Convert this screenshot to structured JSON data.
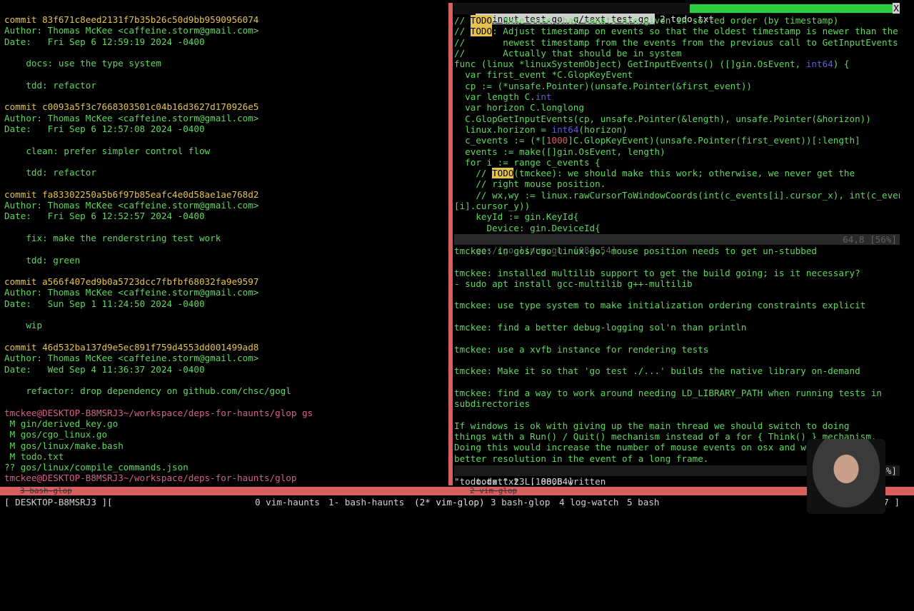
{
  "left_terminal": [
    {
      "t": "commit 83f671c8eed2131f7b35b26c50d9bb9590956074",
      "c": "y"
    },
    {
      "t": "Author: Thomas McKee <caffeine.storm@gmail.com>",
      "c": "g"
    },
    {
      "t": "Date:   Fri Sep 6 12:59:19 2024 -0400",
      "c": "g"
    },
    {
      "t": "",
      "c": "g"
    },
    {
      "t": "    docs: use the type system",
      "c": "g"
    },
    {
      "t": "",
      "c": "g"
    },
    {
      "t": "    tdd: refactor",
      "c": "g"
    },
    {
      "t": "",
      "c": "g"
    },
    {
      "t": "commit c0093a5f3c7668303501c04b16d3627d170926e5",
      "c": "y"
    },
    {
      "t": "Author: Thomas McKee <caffeine.storm@gmail.com>",
      "c": "g"
    },
    {
      "t": "Date:   Fri Sep 6 12:57:08 2024 -0400",
      "c": "g"
    },
    {
      "t": "",
      "c": "g"
    },
    {
      "t": "    clean: prefer simpler control flow",
      "c": "g"
    },
    {
      "t": "",
      "c": "g"
    },
    {
      "t": "    tdd: refactor",
      "c": "g"
    },
    {
      "t": "",
      "c": "g"
    },
    {
      "t": "commit fa83302250a5b6f97b85eafc4e0d58ae1ae768d2",
      "c": "y"
    },
    {
      "t": "Author: Thomas McKee <caffeine.storm@gmail.com>",
      "c": "g"
    },
    {
      "t": "Date:   Fri Sep 6 12:52:57 2024 -0400",
      "c": "g"
    },
    {
      "t": "",
      "c": "g"
    },
    {
      "t": "    fix: make the renderstring test work",
      "c": "g"
    },
    {
      "t": "",
      "c": "g"
    },
    {
      "t": "    tdd: green",
      "c": "g"
    },
    {
      "t": "",
      "c": "g"
    },
    {
      "t": "commit a566f407ed9b0a5723dcc7fbfbf68032fa9e9597",
      "c": "y"
    },
    {
      "t": "Author: Thomas McKee <caffeine.storm@gmail.com>",
      "c": "g"
    },
    {
      "t": "Date:   Sun Sep 1 11:24:50 2024 -0400",
      "c": "g"
    },
    {
      "t": "",
      "c": "g"
    },
    {
      "t": "    wip",
      "c": "g"
    },
    {
      "t": "",
      "c": "g"
    },
    {
      "t": "commit 46d532ba137d9e5ec891f759d4553dd001499ad8",
      "c": "y"
    },
    {
      "t": "Author: Thomas McKee <caffeine.storm@gmail.com>",
      "c": "g"
    },
    {
      "t": "Date:   Wed Sep 4 11:36:37 2024 -0400",
      "c": "g"
    },
    {
      "t": "",
      "c": "g"
    },
    {
      "t": "    refactor: drop dependency on github.com/chsc/gogl",
      "c": "g"
    },
    {
      "t": "",
      "c": "g"
    },
    {
      "t": "tmckee@DESKTOP-B8MSRJ3~/workspace/deps-for-haunts/glop gs",
      "c": "m"
    },
    {
      "t": " M gin/derived_key.go",
      "c": "g"
    },
    {
      "t": " M gos/cgo_linux.go",
      "c": "g"
    },
    {
      "t": " M gos/linux/make.bash",
      "c": "g"
    },
    {
      "t": " M todo.txt",
      "c": "g"
    },
    {
      "t": "?? gos/linux/compile_commands.json",
      "c": "g"
    },
    {
      "t": "tmckee@DESKTOP-B8MSRJ3~/workspace/deps-for-haunts/glop ",
      "c": "m"
    }
  ],
  "vim_tabs": {
    "inactive": " g/input_test.go  g/text_test.go ",
    "active": " 2 todo.txt ",
    "close": "X"
  },
  "code_lines": [
    [
      {
        "t": "// "
      },
      {
        "t": "TODO",
        "k": "todo"
      },
      {
        "t": ": Make sure that events are given in sorted order (by timestamp)"
      }
    ],
    [
      {
        "t": "// "
      },
      {
        "t": "TODO",
        "k": "todo"
      },
      {
        "t": ": Adjust timestamp on events so that the oldest timestamp is newer than the"
      }
    ],
    [
      {
        "t": "//       newest timestamp from the events from the previous call to GetInputEvents"
      }
    ],
    [
      {
        "t": "//       Actually that should be in system"
      }
    ],
    [
      {
        "t": "func (linux *linuxSystemObject) GetInputEvents() ([]gin.OsEvent, "
      },
      {
        "t": "int64",
        "k": "ty"
      },
      {
        "t": ") {"
      }
    ],
    [
      {
        "t": "  var first_event *C.GlopKeyEvent"
      }
    ],
    [
      {
        "t": "  cp := (*unsafe.Pointer)(unsafe.Pointer(&first_event))"
      }
    ],
    [
      {
        "t": "  var length C."
      },
      {
        "t": "int",
        "k": "ty"
      }
    ],
    [
      {
        "t": "  var horizon C.longlong"
      }
    ],
    [
      {
        "t": "  C.GlopGetInputEvents(cp, unsafe.Pointer(&length), unsafe.Pointer(&horizon))"
      }
    ],
    [
      {
        "t": "  linux.horizon = "
      },
      {
        "t": "int64",
        "k": "ty"
      },
      {
        "t": "(horizon)"
      }
    ],
    [
      {
        "t": "  c_events := (*["
      },
      {
        "t": "1000",
        "k": "num"
      },
      {
        "t": "]C.GlopKeyEvent)(unsafe.Pointer(first_event))[:length]"
      }
    ],
    [
      {
        "t": "  events := make([]gin.OsEvent, length)"
      }
    ],
    [
      {
        "t": "  for i := range c_events {"
      }
    ],
    [
      {
        "t": "    // "
      },
      {
        "t": "TODO",
        "k": "todo"
      },
      {
        "t": "(tmckee): we should make this work; otherwise, we never get the"
      }
    ],
    [
      {
        "t": "    // right mouse position."
      }
    ],
    [
      {
        "t": "    // wx,wy := linux.rawCursorToWindowCoords(int(c_events[i].cursor_x), int(c_events"
      }
    ],
    [
      {
        "t": "[i].cursor_y))"
      }
    ],
    [
      {
        "t": "    keyId := gin.KeyId{"
      }
    ],
    [
      {
        "t": "      Device: gin.DeviceId{"
      }
    ]
  ],
  "status1": {
    "file": "gos/cgo_linux.go  [084,54]",
    "pos": "64,8 [56%]"
  },
  "notes_lines": [
    "tmckee: in gos/cgo_linux.go, mouse position needs to get un-stubbed",
    "",
    "tmckee: installed multilib support to get the build going; is it necessary?",
    "- sudo apt install gcc-multilib g++-multilib",
    "",
    "tmckee: use type system to make initialization ordering constraints explicit",
    "",
    "tmckee: find a better debug-logging sol'n than println",
    "",
    "tmckee: use a xvfb instance for rendering tests",
    "",
    "tmckee: Make it so that 'go test ./...' builds the native library on-demand",
    "",
    "tmckee: find a way to work around needing LD_LIBRARY_PATH when running tests in",
    "subdirectories",
    "",
    "If windows is ok with giving up the main thread we should switch to doing",
    "things with a Run() / Quit() mechanism instead of a for { Think() } mechanism.",
    "Doing this would increase the number of mouse events on osx and would give",
    "better resolution in the event of a long frame."
  ],
  "status2": {
    "file": "todo.txt  [100,64]",
    "pos": "1,67 [4%]"
  },
  "cmdline": "\"todo.txt\" 23L, 880B written",
  "pane_labels": {
    "left": "3 bash-glop",
    "right": "2 vim-glop"
  },
  "tmux": {
    "session": "[ DESKTOP-B8MSRJ3 ][",
    "windows": [
      "0 vim-haunts",
      "1- bash-haunts",
      "(2* vim-glop)",
      "3 bash-glop",
      "4 log-watch",
      "5 bash"
    ],
    "clock": ":17 ]"
  },
  "colors": {
    "accent": "#d75f5f",
    "green": "#5fd75f",
    "yellow": "#e5c34a",
    "magenta": "#d75f87"
  }
}
